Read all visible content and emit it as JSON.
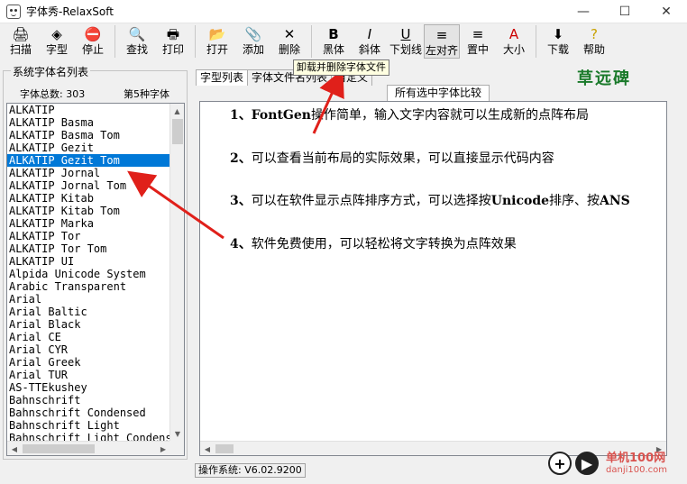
{
  "window": {
    "title": "字体秀-RelaxSoft",
    "minimize": "—",
    "maximize": "☐",
    "close": "✕"
  },
  "toolbar": {
    "buttons": [
      {
        "id": "scan",
        "label": "扫描",
        "icon": "scan-icon",
        "glyph": "🖨"
      },
      {
        "id": "font",
        "label": "字型",
        "icon": "font-icon",
        "glyph": "◈"
      },
      {
        "id": "stop",
        "label": "停止",
        "icon": "stop-icon",
        "glyph": "⛔"
      },
      {
        "id": "find",
        "label": "查找",
        "icon": "find-icon",
        "glyph": "🔍"
      },
      {
        "id": "print",
        "label": "打印",
        "icon": "print-icon",
        "glyph": "🖶"
      },
      {
        "id": "open",
        "label": "打开",
        "icon": "open-folder-icon",
        "glyph": "📂"
      },
      {
        "id": "add",
        "label": "添加",
        "icon": "paperclip-icon",
        "glyph": "📎"
      },
      {
        "id": "delete",
        "label": "删除",
        "icon": "delete-x-icon",
        "glyph": "✕"
      },
      {
        "id": "bold",
        "label": "黑体",
        "icon": "bold-icon",
        "glyph": "B"
      },
      {
        "id": "italic",
        "label": "斜体",
        "icon": "italic-icon",
        "glyph": "I"
      },
      {
        "id": "underline",
        "label": "下划线",
        "icon": "underline-icon",
        "glyph": "U"
      },
      {
        "id": "align-left",
        "label": "左对齐",
        "icon": "align-left-icon",
        "glyph": "≡"
      },
      {
        "id": "center",
        "label": "置中",
        "icon": "align-center-icon",
        "glyph": "≡"
      },
      {
        "id": "size",
        "label": "大小",
        "icon": "font-size-icon",
        "glyph": "A"
      },
      {
        "id": "download",
        "label": "下载",
        "icon": "download-icon",
        "glyph": "⬇"
      },
      {
        "id": "help",
        "label": "帮助",
        "icon": "help-icon",
        "glyph": "?"
      }
    ],
    "tooltip": "卸载并删除字体文件"
  },
  "left_panel": {
    "group_title": "系统字体名列表",
    "count_label": "字体总数: 303",
    "index_label": "第5种字体",
    "fonts": [
      "ALKATIP",
      "ALKATIP Basma",
      "ALKATIP Basma Tom",
      "ALKATIP Gezit",
      "ALKATIP Gezit Tom",
      "ALKATIP Jornal",
      "ALKATIP Jornal Tom",
      "ALKATIP Kitab",
      "ALKATIP Kitab Tom",
      "ALKATIP Marka",
      "ALKATIP Tor",
      "ALKATIP Tor Tom",
      "ALKATIP UI",
      "Alpida Unicode System",
      "Arabic Transparent",
      "Arial",
      "Arial Baltic",
      "Arial Black",
      "Arial CE",
      "Arial CYR",
      "Arial Greek",
      "Arial TUR",
      "AS-TTEkushey",
      "Bahnschrift",
      "Bahnschrift Condensed",
      "Bahnschrift Light",
      "Bahnschrift Light Condensed"
    ],
    "selected_index": 4
  },
  "right_panel": {
    "tabs": [
      "字型列表",
      "字体文件名列表",
      "自定义"
    ],
    "subtab": "所有选中字体比较",
    "logo_text": "草远碑",
    "paragraphs": [
      {
        "num": "1、",
        "bold": "FontGen",
        "text": "操作简单，输入文字内容就可以生成新的点阵布局"
      },
      {
        "num": "2、",
        "bold": "",
        "text": "可以查看当前布局的实际效果，可以直接显示代码内容"
      },
      {
        "num": "3、",
        "bold": "",
        "text": "可以在软件显示点阵排序方式，可以选择按",
        "bold2": "Unicode",
        "text2": "排序、按",
        "bold3": "ANS"
      },
      {
        "num": "4、",
        "bold": "",
        "text": "软件免费使用，可以轻松将文字转换为点阵效果"
      }
    ]
  },
  "status": {
    "os": "操作系统:   V6.02.9200"
  },
  "watermark": {
    "cn": "单机100网",
    "en": "danji100.com"
  },
  "colors": {
    "selection": "#0078d7",
    "arrow": "#e0201a",
    "logo": "#1a7a2a"
  }
}
